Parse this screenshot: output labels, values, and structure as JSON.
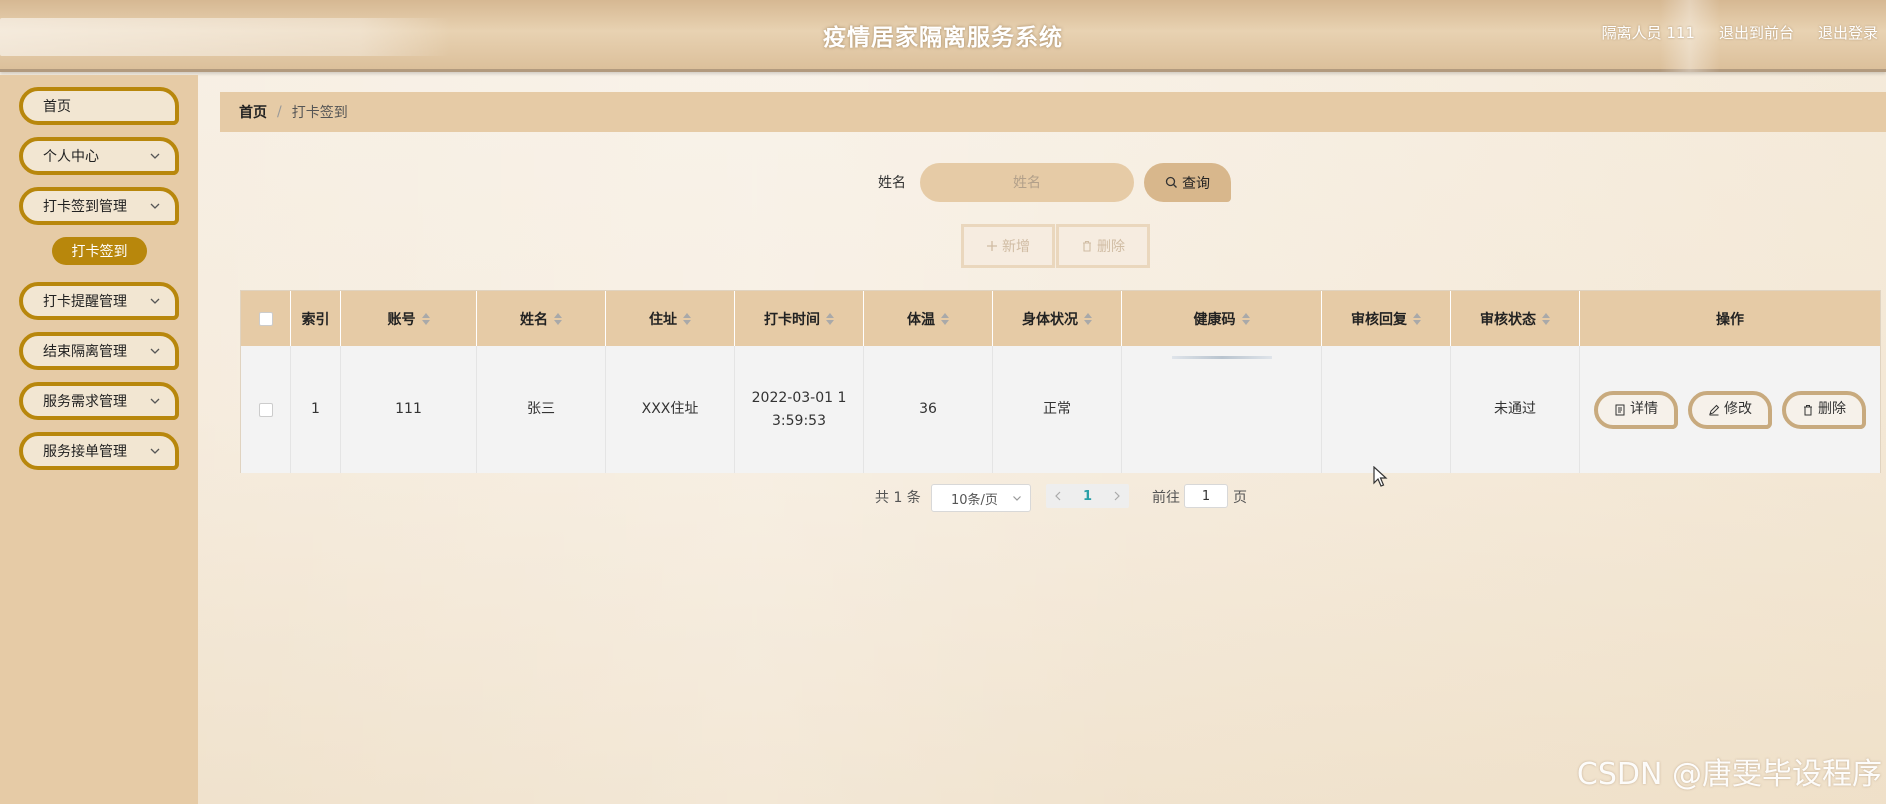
{
  "header": {
    "app_title": "疫情居家隔离服务系统",
    "user_label": "隔离人员 111",
    "exit_to_front": "退出到前台",
    "logout": "退出登录"
  },
  "sidebar": {
    "items": [
      {
        "label": "首页",
        "has_submenu": false
      },
      {
        "label": "个人中心",
        "has_submenu": true
      },
      {
        "label": "打卡签到管理",
        "has_submenu": true
      },
      {
        "label": "打卡提醒管理",
        "has_submenu": true
      },
      {
        "label": "结束隔离管理",
        "has_submenu": true
      },
      {
        "label": "服务需求管理",
        "has_submenu": true
      },
      {
        "label": "服务接单管理",
        "has_submenu": true
      }
    ],
    "active_submenu": "打卡签到"
  },
  "breadcrumb": {
    "home": "首页",
    "separator": "/",
    "current": "打卡签到"
  },
  "search": {
    "label": "姓名",
    "placeholder": "姓名",
    "button_label": "查询"
  },
  "actions": {
    "add_label": "新增",
    "delete_label": "删除"
  },
  "table": {
    "columns": [
      "索引",
      "账号",
      "姓名",
      "住址",
      "打卡时间",
      "体温",
      "身体状况",
      "健康码",
      "审核回复",
      "审核状态",
      "操作"
    ],
    "rows": [
      {
        "index": "1",
        "account": "111",
        "name": "张三",
        "address": "XXX住址",
        "checkin_time": "2022-03-01 13:59:53",
        "temperature": "36",
        "condition": "正常",
        "health_code": "",
        "review_reply": "",
        "review_status": "未通过",
        "op_detail": "详情",
        "op_edit": "修改",
        "op_delete": "删除"
      }
    ]
  },
  "pagination": {
    "total": "共 1 条",
    "page_size": "10条/页",
    "current_page": "1",
    "goto_label": "前往",
    "goto_value": "1",
    "page_unit": "页"
  },
  "watermark": "CSDN @唐雯毕设程序",
  "colors": {
    "accent_gold": "#b8870c",
    "tan": "#e6cba6"
  }
}
